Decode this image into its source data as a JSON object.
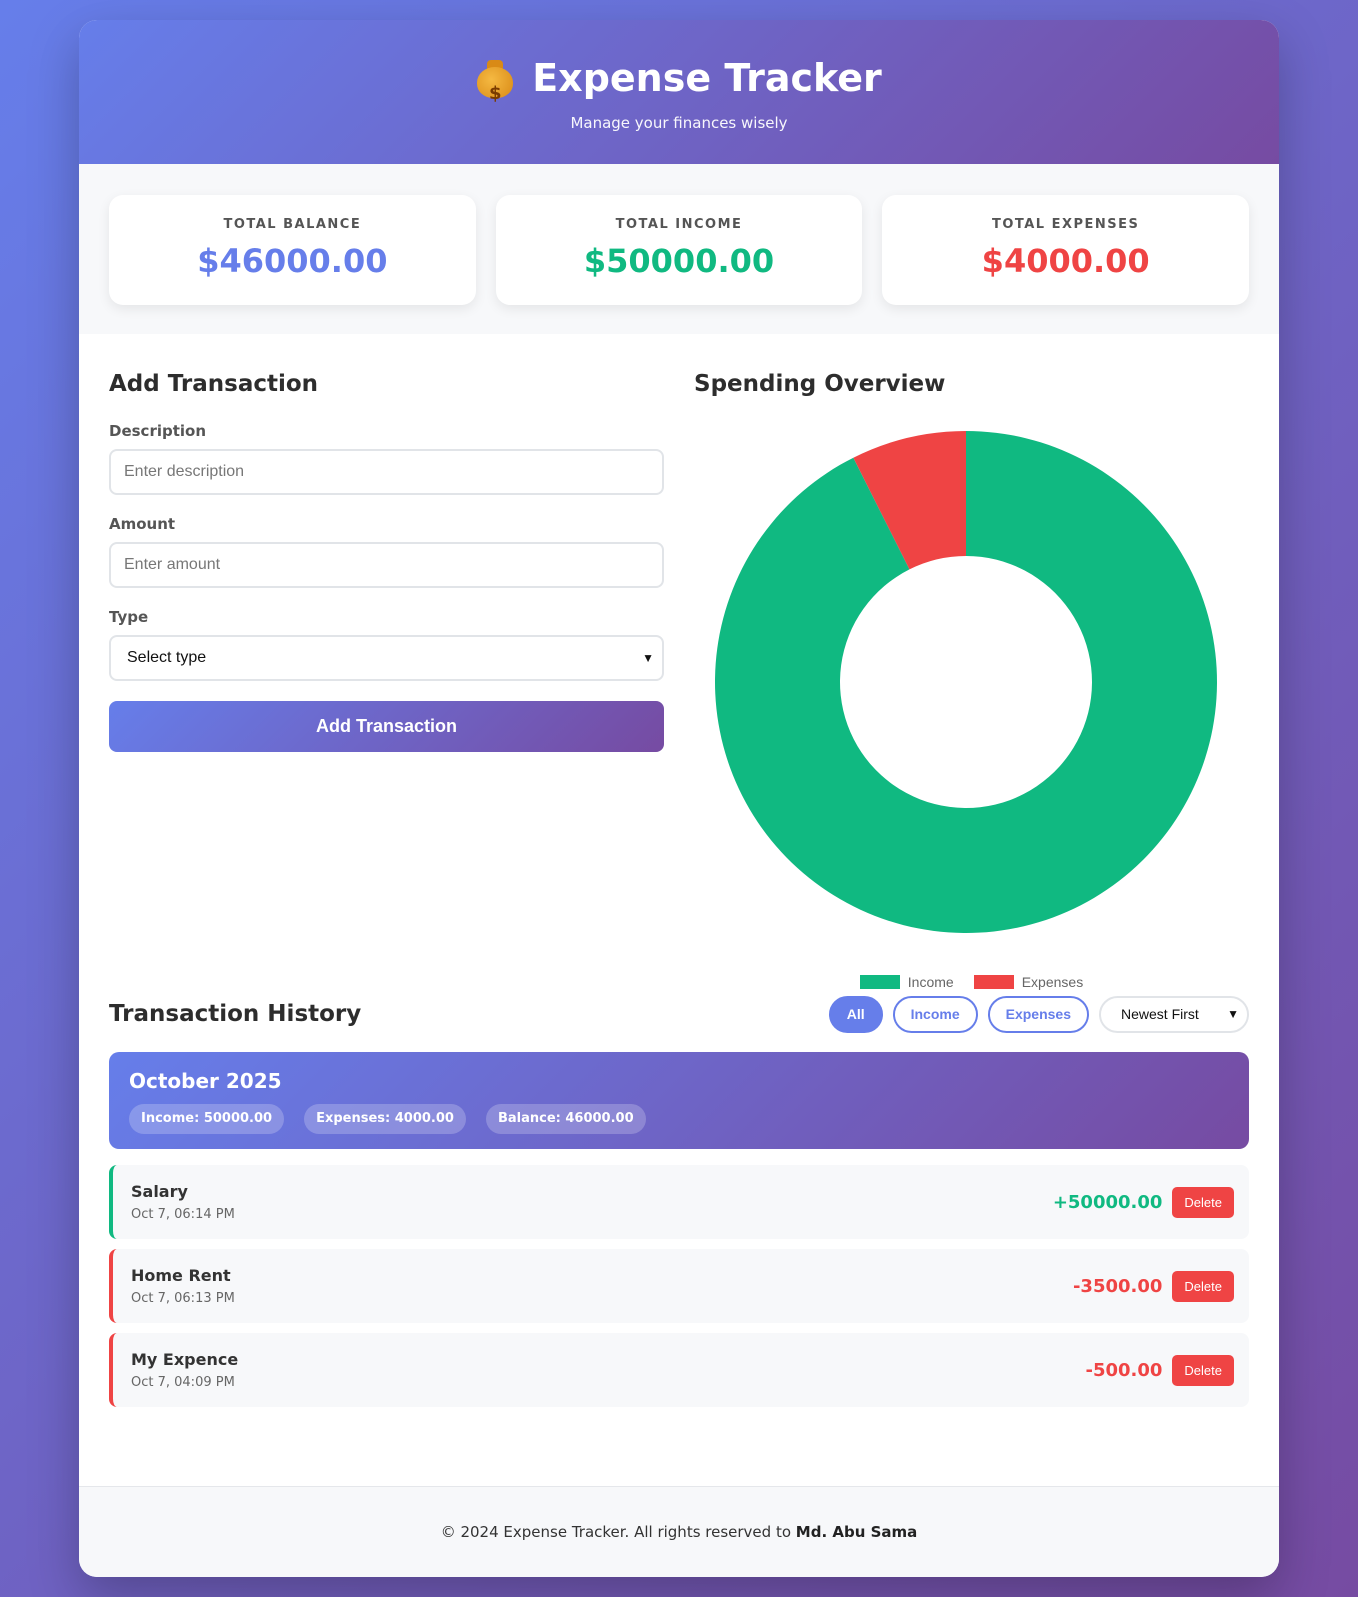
{
  "header": {
    "title": "Expense Tracker",
    "subtitle": "Manage your finances wisely",
    "icon": "money-bag-icon"
  },
  "summary": {
    "balance": {
      "label": "TOTAL BALANCE",
      "value": "$46000.00",
      "color": "#667eea"
    },
    "income": {
      "label": "TOTAL INCOME",
      "value": "$50000.00",
      "color": "#10b981"
    },
    "expenses": {
      "label": "TOTAL EXPENSES",
      "value": "$4000.00",
      "color": "#ef4444"
    }
  },
  "form": {
    "title": "Add Transaction",
    "description_label": "Description",
    "description_placeholder": "Enter description",
    "amount_label": "Amount",
    "amount_placeholder": "Enter amount",
    "type_label": "Type",
    "type_selected": "Select type",
    "submit_label": "Add Transaction"
  },
  "chart": {
    "title": "Spending Overview"
  },
  "chart_data": {
    "type": "pie",
    "variant": "doughnut",
    "categories": [
      "Income",
      "Expenses"
    ],
    "values": [
      50000,
      4000
    ],
    "colors": [
      "#10b981",
      "#ef4444"
    ],
    "legend_position": "bottom"
  },
  "history": {
    "title": "Transaction History",
    "filters": [
      "All",
      "Income",
      "Expenses"
    ],
    "active_filter": "All",
    "sort_selected": "Newest First",
    "month": {
      "title": "October 2025",
      "income": "Income: 50000.00",
      "expenses": "Expenses: 4000.00",
      "balance": "Balance: 46000.00"
    },
    "transactions": [
      {
        "name": "Salary",
        "date": "Oct 7, 06:14 PM",
        "amount": "+50000.00",
        "kind": "income",
        "delete_label": "Delete"
      },
      {
        "name": "Home Rent",
        "date": "Oct 7, 06:13 PM",
        "amount": "-3500.00",
        "kind": "expense",
        "delete_label": "Delete"
      },
      {
        "name": "My Expence",
        "date": "Oct 7, 04:09 PM",
        "amount": "-500.00",
        "kind": "expense",
        "delete_label": "Delete"
      }
    ]
  },
  "footer": {
    "text": "© 2024 Expense Tracker. All rights reserved to",
    "author": "Md. Abu Sama"
  }
}
